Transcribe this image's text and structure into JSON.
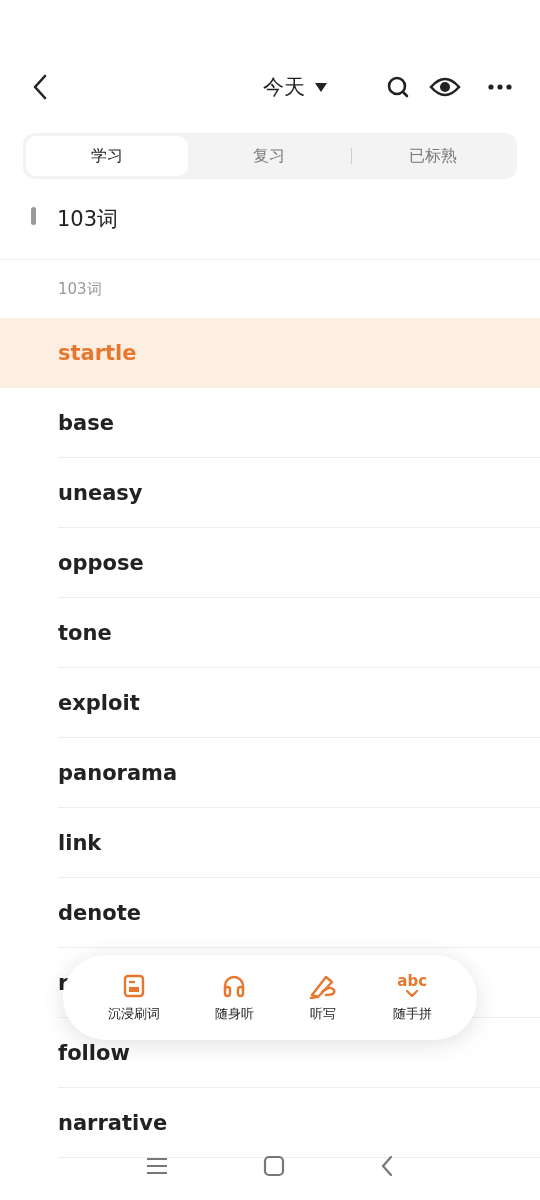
{
  "header": {
    "title": "今天"
  },
  "tabs": [
    {
      "label": "学习",
      "selected": true
    },
    {
      "label": "复习",
      "selected": false
    },
    {
      "label": "已标熟",
      "selected": false
    }
  ],
  "section": {
    "title": "103词",
    "subtitle": "103词"
  },
  "words": [
    {
      "word": "startle",
      "selected": true
    },
    {
      "word": "base",
      "selected": false
    },
    {
      "word": "uneasy",
      "selected": false
    },
    {
      "word": "oppose",
      "selected": false
    },
    {
      "word": "tone",
      "selected": false
    },
    {
      "word": "exploit",
      "selected": false
    },
    {
      "word": "panorama",
      "selected": false
    },
    {
      "word": "link",
      "selected": false
    },
    {
      "word": "denote",
      "selected": false
    },
    {
      "word": "r",
      "selected": false
    },
    {
      "word": "follow",
      "selected": false
    },
    {
      "word": "narrative",
      "selected": false
    }
  ],
  "toolbar": [
    {
      "kind": "card",
      "label": "沉浸刷词"
    },
    {
      "kind": "headphones",
      "label": "随身听"
    },
    {
      "kind": "pen",
      "label": "听写"
    },
    {
      "kind": "abc",
      "label": "随手拼",
      "icon_text": "abc"
    }
  ]
}
